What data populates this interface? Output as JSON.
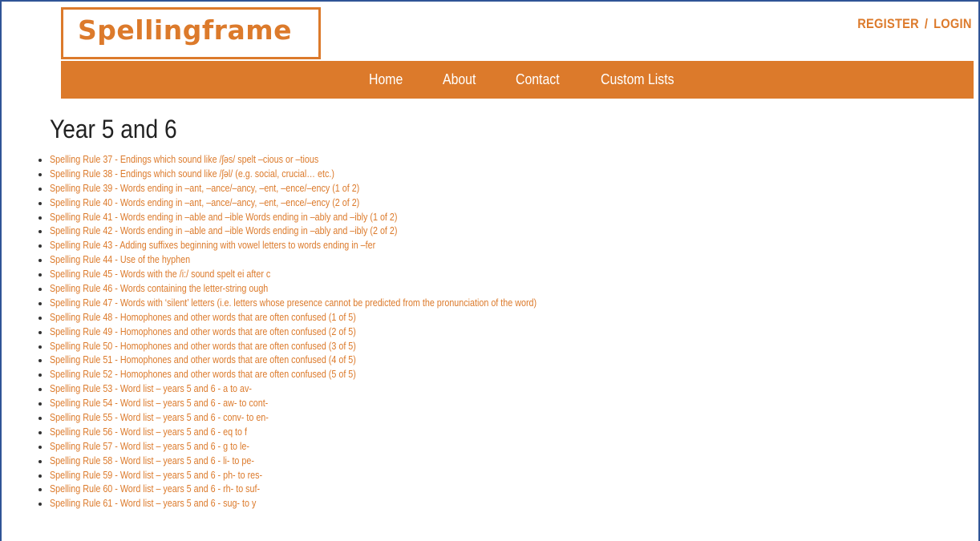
{
  "brand": {
    "logo_text": "Spellingframe",
    "accent_color": "#dc7a2b"
  },
  "auth": {
    "register_label": "REGISTER",
    "separator": "/",
    "login_label": "LOGIN"
  },
  "nav": {
    "items": [
      {
        "label": "Home"
      },
      {
        "label": "About"
      },
      {
        "label": "Contact"
      },
      {
        "label": "Custom Lists"
      }
    ]
  },
  "page": {
    "title": "Year 5 and 6"
  },
  "rules": [
    {
      "label": "Spelling Rule 37 - Endings which sound like /ʃəs/ spelt –cious or –tious"
    },
    {
      "label": "Spelling Rule 38 - Endings which sound like /ʃəl/ (e.g. social, crucial… etc.)"
    },
    {
      "label": "Spelling Rule 39 - Words ending in –ant, –ance/–ancy, –ent, –ence/–ency (1 of 2)"
    },
    {
      "label": "Spelling Rule 40 - Words ending in –ant, –ance/–ancy, –ent, –ence/–ency (2 of 2)"
    },
    {
      "label": "Spelling Rule 41 - Words ending in –able and –ible Words ending in –ably and –ibly (1 of 2)"
    },
    {
      "label": "Spelling Rule 42 - Words ending in –able and –ible Words ending in –ably and –ibly (2 of 2)"
    },
    {
      "label": "Spelling Rule 43 - Adding suffixes beginning with vowel letters to words ending in –fer"
    },
    {
      "label": "Spelling Rule 44 - Use of the hyphen"
    },
    {
      "label": "Spelling Rule 45 - Words with the /i:/ sound spelt ei after c"
    },
    {
      "label": "Spelling Rule 46 - Words containing the letter-string ough"
    },
    {
      "label": "Spelling Rule 47 - Words with ‘silent’ letters (i.e. letters whose presence cannot be predicted from the pronunciation of the word)"
    },
    {
      "label": "Spelling Rule 48 - Homophones and other words that are often confused (1 of 5)"
    },
    {
      "label": "Spelling Rule 49 - Homophones and other words that are often confused (2 of 5)"
    },
    {
      "label": "Spelling Rule 50 - Homophones and other words that are often confused (3 of 5)"
    },
    {
      "label": "Spelling Rule 51 - Homophones and other words that are often confused (4 of 5)"
    },
    {
      "label": "Spelling Rule 52 - Homophones and other words that are often confused (5 of 5)"
    },
    {
      "label": "Spelling Rule 53 - Word list – years 5 and 6 - a to av-"
    },
    {
      "label": "Spelling Rule 54 - Word list – years 5 and 6 - aw- to cont-"
    },
    {
      "label": "Spelling Rule 55 - Word list – years 5 and 6 - conv- to en-"
    },
    {
      "label": "Spelling Rule 56 - Word list – years 5 and 6 - eq to f"
    },
    {
      "label": "Spelling Rule 57 - Word list – years 5 and 6 - g to le-"
    },
    {
      "label": "Spelling Rule 58 - Word list – years 5 and 6 - li- to pe-"
    },
    {
      "label": "Spelling Rule 59 - Word list – years 5 and 6 - ph- to res-"
    },
    {
      "label": "Spelling Rule 60 - Word list – years 5 and 6 - rh- to suf-"
    },
    {
      "label": "Spelling Rule 61 - Word list – years 5 and 6 - sug- to y"
    }
  ]
}
